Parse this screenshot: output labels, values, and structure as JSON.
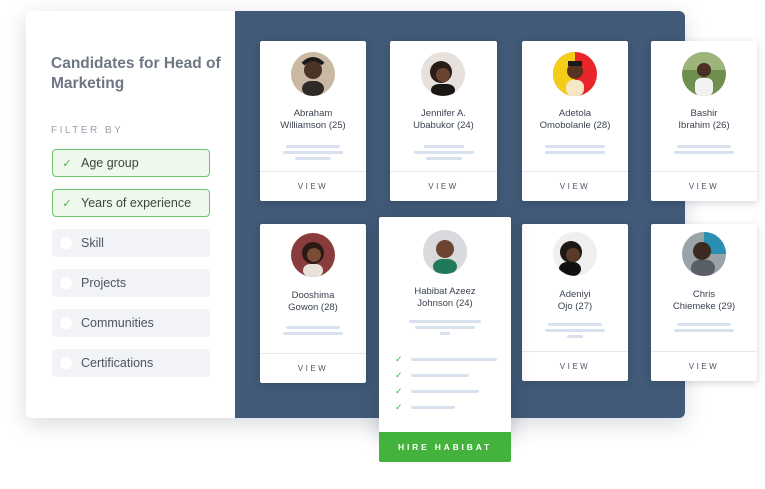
{
  "sidebar": {
    "title": "Candidates for Head of Marketing",
    "filter_label": "FILTER BY",
    "filters": [
      {
        "label": "Age group",
        "checked": true
      },
      {
        "label": "Years of experience",
        "checked": true
      },
      {
        "label": "Skill",
        "checked": false
      },
      {
        "label": "Projects",
        "checked": false
      },
      {
        "label": "Communities",
        "checked": false
      },
      {
        "label": "Certifications",
        "checked": false
      }
    ]
  },
  "candidates": [
    {
      "name1": "Abraham",
      "name2": "Williamson (25)",
      "view": "VIEW"
    },
    {
      "name1": "Jennifer A.",
      "name2": "Ubabukor (24)",
      "view": "VIEW"
    },
    {
      "name1": "Adetola",
      "name2": "Omobolanle (28)",
      "view": "VIEW"
    },
    {
      "name1": "Bashir",
      "name2": "Ibrahim (26)",
      "view": "VIEW"
    },
    {
      "name1": "Dooshima",
      "name2": "Gowon (28)",
      "view": "VIEW"
    },
    {
      "name1": "Habibat Azeez",
      "name2": "Johnson (24)"
    },
    {
      "name1": "Adeniyi",
      "name2": "Ojo (27)",
      "view": "VIEW"
    },
    {
      "name1": "Chris",
      "name2": "Chiemeke (29)",
      "view": "VIEW"
    }
  ],
  "hire_button": "HIRE HABIBAT",
  "colors": {
    "accent_green": "#43b33e",
    "grid_bg": "#415a77"
  }
}
